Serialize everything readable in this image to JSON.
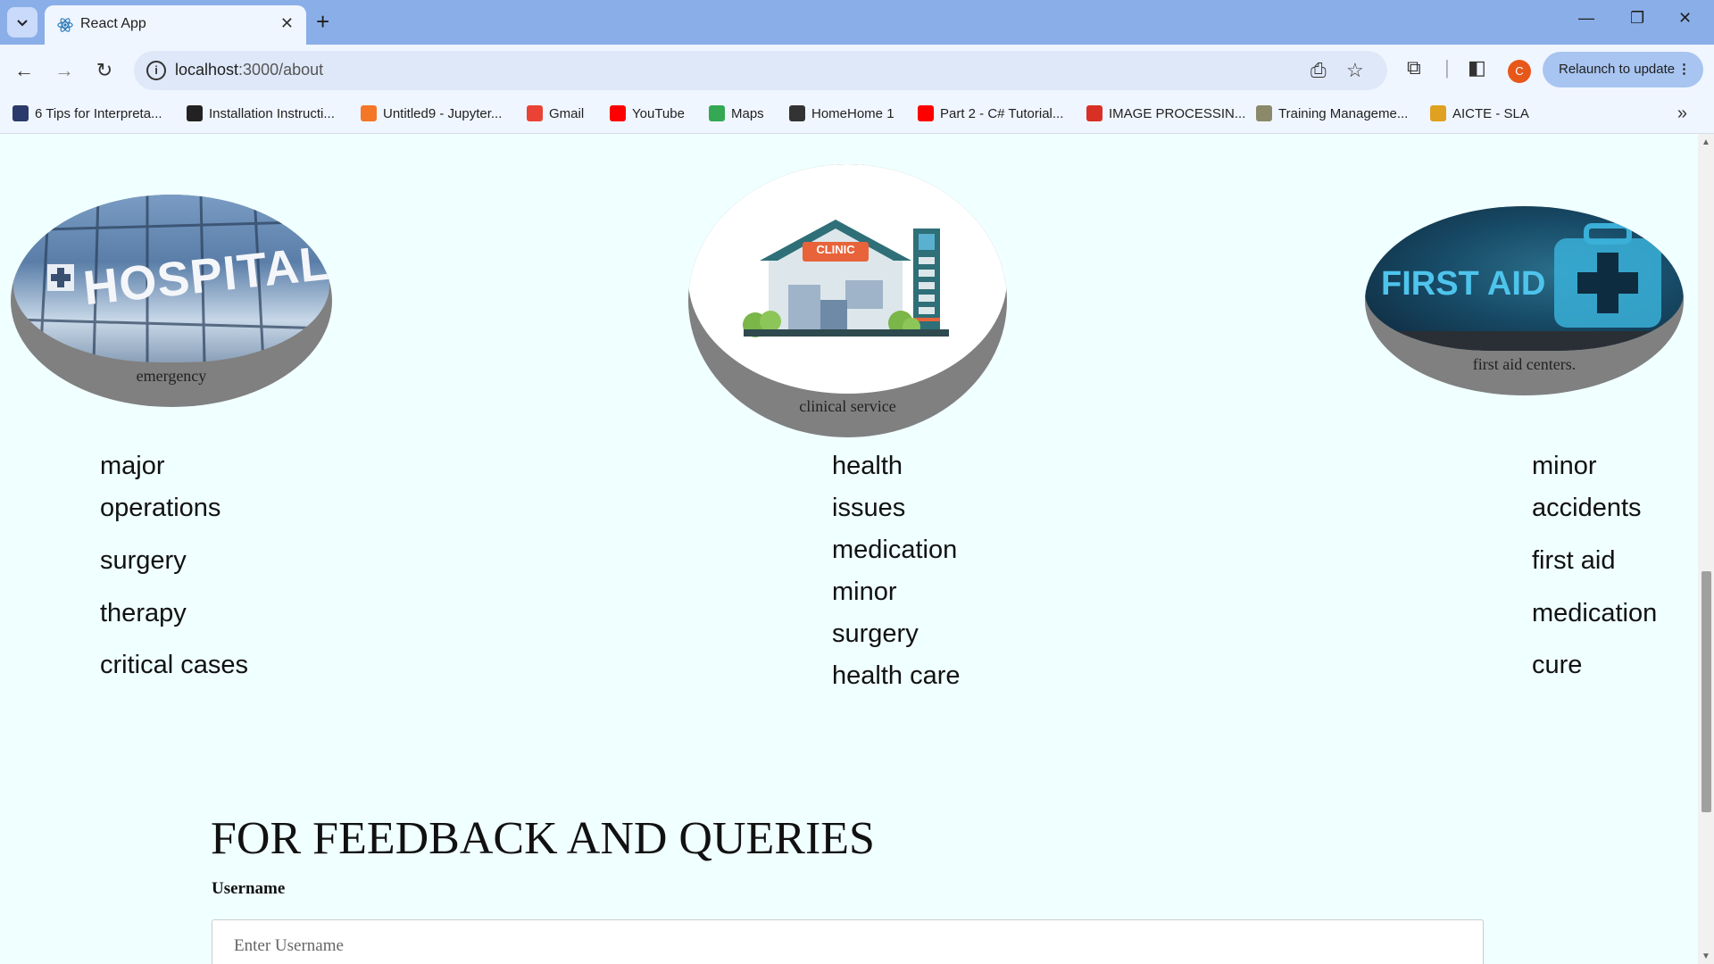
{
  "browser": {
    "tab_title": "React App",
    "url_host": "localhost",
    "url_path": ":3000/about",
    "relaunch_label": "Relaunch to update",
    "profile_initial": "C",
    "bookmarks": [
      {
        "label": "6 Tips for Interpreta...",
        "icon": "tds-icon",
        "color": "#2a3a6a"
      },
      {
        "label": "Installation Instructi...",
        "icon": "github-icon",
        "color": "#222222"
      },
      {
        "label": "Untitled9 - Jupyter...",
        "icon": "jupyter-icon",
        "color": "#f37726"
      },
      {
        "label": "Gmail",
        "icon": "gmail-icon",
        "color": "#ea4335"
      },
      {
        "label": "YouTube",
        "icon": "youtube-icon",
        "color": "#ff0000"
      },
      {
        "label": "Maps",
        "icon": "maps-icon",
        "color": "#34a853"
      },
      {
        "label": "HomeHome 1",
        "icon": "globe-icon",
        "color": "#333333"
      },
      {
        "label": "Part 2 - C# Tutorial...",
        "icon": "youtube-icon",
        "color": "#ff0000"
      },
      {
        "label": "IMAGE PROCESSIN...",
        "icon": "pdf-icon",
        "color": "#d93025"
      },
      {
        "label": "Training Manageme...",
        "icon": "training-icon",
        "color": "#8a8a6a"
      },
      {
        "label": "AICTE - SLA",
        "icon": "aicte-icon",
        "color": "#e0a020"
      }
    ]
  },
  "services": [
    {
      "caption": "emergency",
      "image_text": "HOSPITAL",
      "items": [
        "major",
        "operations",
        "surgery",
        "therapy",
        "critical cases"
      ]
    },
    {
      "caption": "clinical service",
      "image_text": "CLINIC",
      "items": [
        "health",
        "issues",
        "medication",
        "minor",
        "surgery",
        "health care"
      ]
    },
    {
      "caption": "first aid centers.",
      "image_text": "FIRST AID",
      "items": [
        "minor",
        "accidents",
        "first aid",
        "medication",
        "cure"
      ]
    }
  ],
  "feedback": {
    "title": "FOR FEEDBACK AND QUERIES",
    "username_label": "Username",
    "username_placeholder": "Enter Username",
    "username_value": ""
  },
  "colors": {
    "page_bg": "#f0ffff",
    "card_gray": "#808080",
    "tabstrip": "#8aaee8"
  }
}
